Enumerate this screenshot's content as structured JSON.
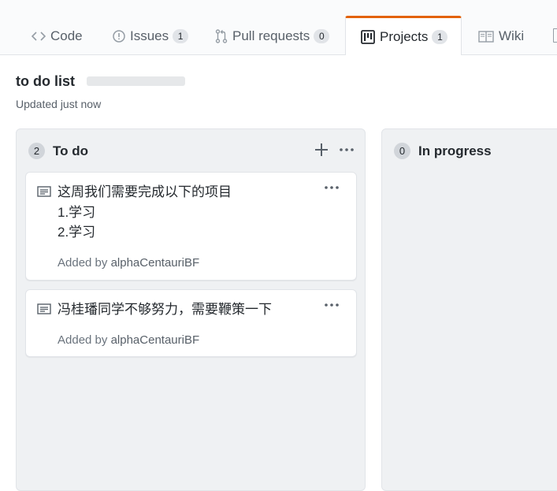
{
  "tabs": [
    {
      "label": "Code",
      "icon": "code-icon"
    },
    {
      "label": "Issues",
      "count": "1",
      "icon": "issue-opened-icon"
    },
    {
      "label": "Pull requests",
      "count": "0",
      "icon": "git-pull-request-icon"
    },
    {
      "label": "Projects",
      "count": "1",
      "icon": "project-icon",
      "selected": true
    },
    {
      "label": "Wiki",
      "icon": "book-icon"
    }
  ],
  "project": {
    "title": "to do list",
    "updated": "Updated just now"
  },
  "columns": [
    {
      "name": "To do",
      "count": "2",
      "cards": [
        {
          "lines": [
            "这周我们需要完成以下的项目",
            "1.学习",
            "2.学习"
          ],
          "added_prefix": "Added by",
          "author": "alphaCentauriBF"
        },
        {
          "lines": [
            "冯桂璠同学不够努力，需要鞭策一下"
          ],
          "added_prefix": "Added by",
          "author": "alphaCentauriBF"
        }
      ]
    },
    {
      "name": "In progress",
      "count": "0",
      "cards": []
    }
  ],
  "colors": {
    "selected_tab_accent": "#e36209",
    "column_bg": "#eff1f3",
    "muted_text": "#586069"
  }
}
